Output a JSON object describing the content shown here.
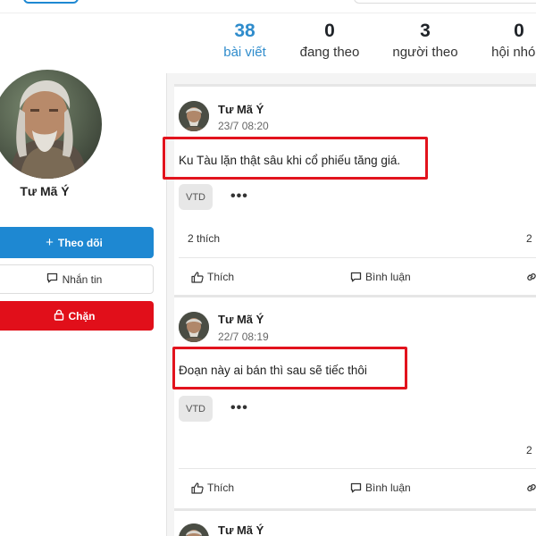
{
  "stats": [
    {
      "number": "38",
      "label": "bài viết"
    },
    {
      "number": "0",
      "label": "đang theo"
    },
    {
      "number": "3",
      "label": "người theo"
    },
    {
      "number": "0",
      "label": "hội nhóm"
    }
  ],
  "profile": {
    "name": "Tư Mã Ý"
  },
  "sidebar": {
    "follow_label": "Theo dõi",
    "message_label": "Nhắn tin",
    "block_label": "Chặn"
  },
  "posts": [
    {
      "author": "Tư Mã Ý",
      "time": "23/7 08:20",
      "text": "Ku Tàu lặn thật sâu khi cổ phiếu tăng giá.",
      "tag": "VTD",
      "more": "•••",
      "likes": "2 thích",
      "right_count": "2",
      "like_label": "Thích",
      "comment_label": "Bình luận"
    },
    {
      "author": "Tư Mã Ý",
      "time": "22/7 08:19",
      "text": "Đoạn này ai bán thì sau sẽ tiếc thôi",
      "tag": "VTD",
      "more": "•••",
      "right_count": "2",
      "like_label": "Thích",
      "comment_label": "Bình luận"
    },
    {
      "author": "Tư Mã Ý"
    }
  ],
  "colors": {
    "accent_blue": "#1e88d2",
    "block_red": "#e10f1a",
    "highlight_red": "#e2131d"
  }
}
